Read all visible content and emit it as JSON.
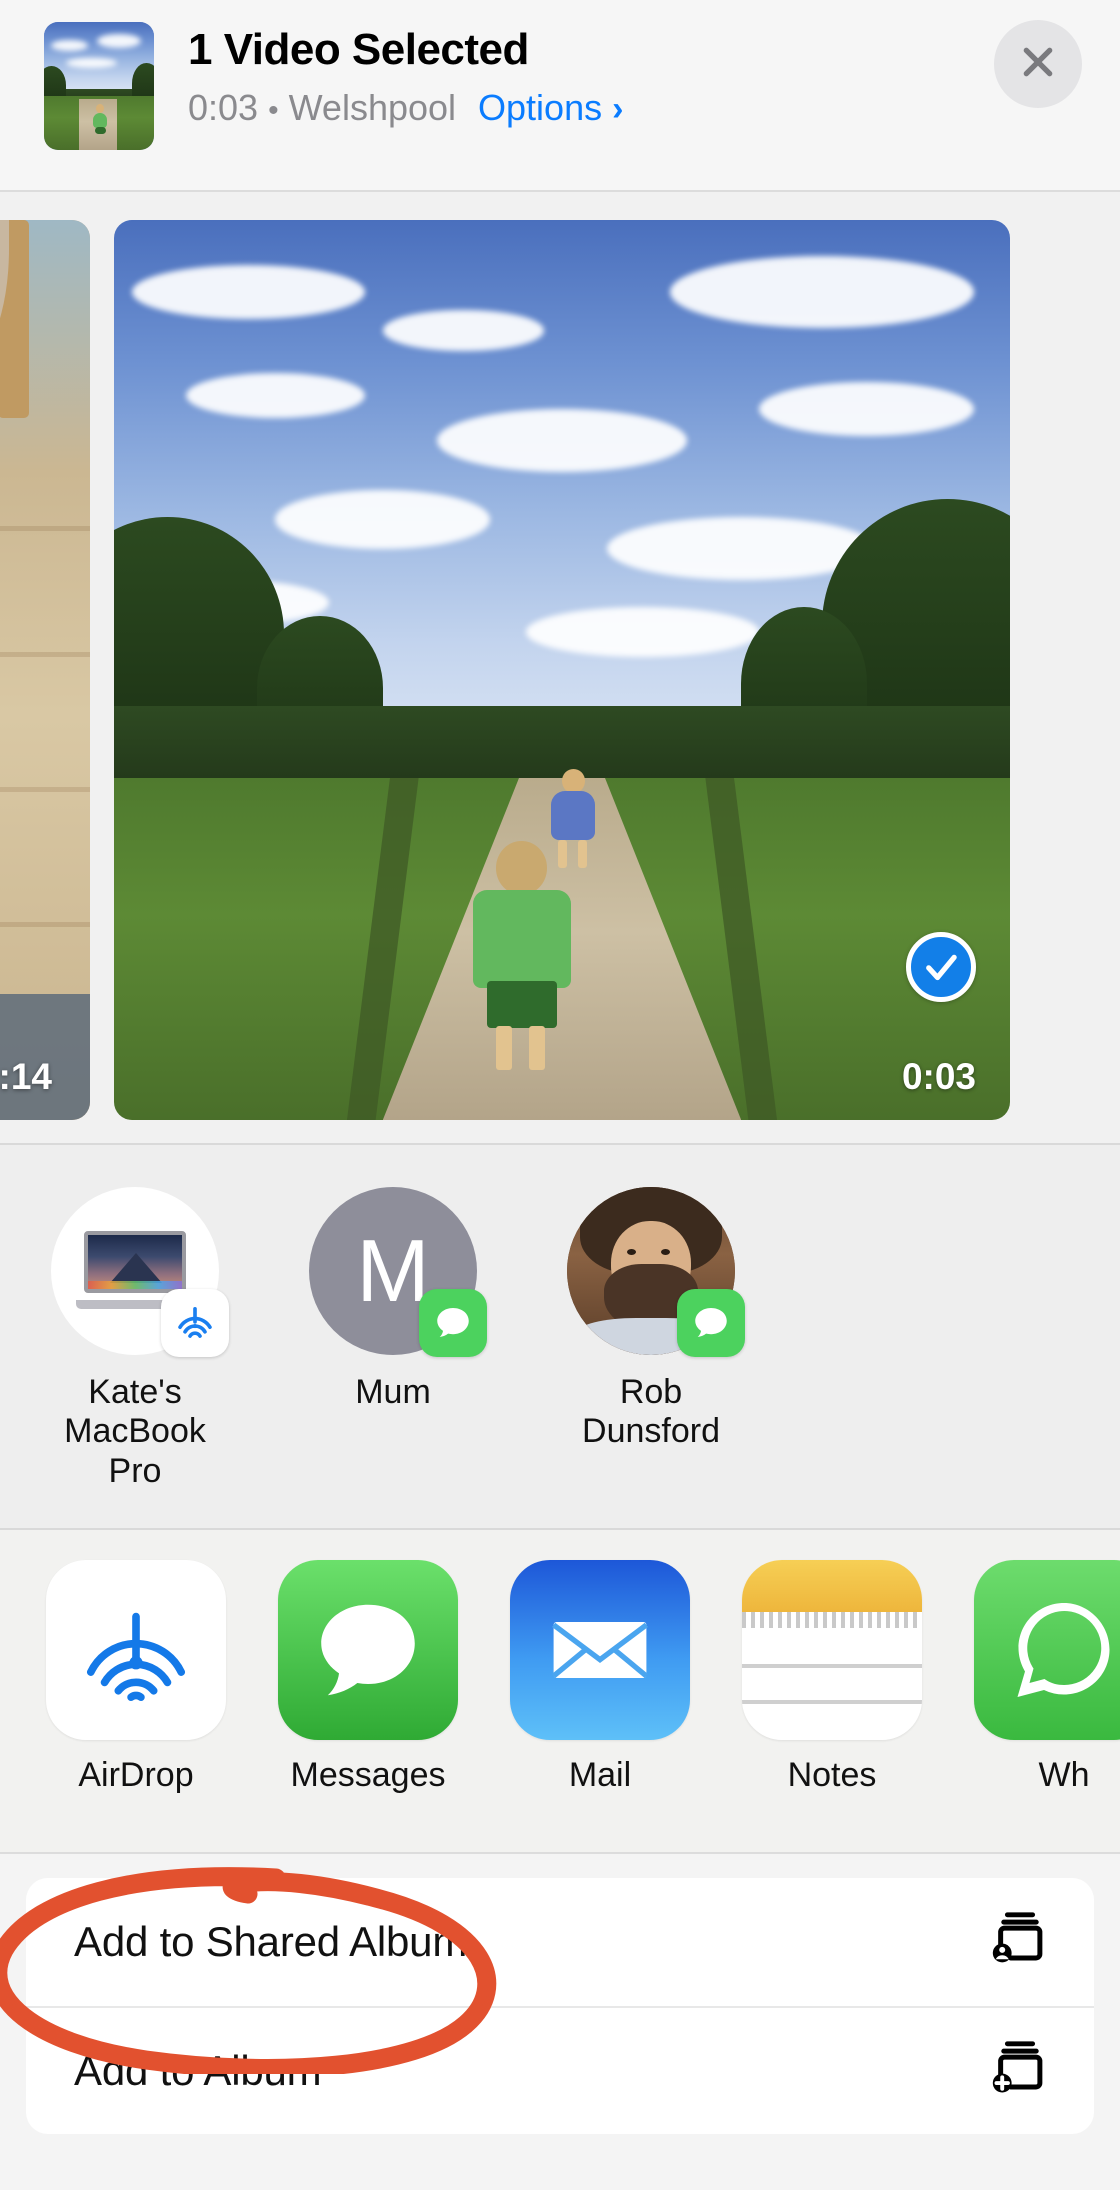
{
  "header": {
    "title": "1 Video Selected",
    "duration": "0:03",
    "separator": "•",
    "location": "Welshpool",
    "options_label": "Options",
    "options_chevron": "›",
    "close_icon": "close-icon",
    "thumbnail_icon": "video-thumbnail"
  },
  "photo_strip": {
    "previous": {
      "duration": ":14",
      "selected": false,
      "select_icon": "unselected-circle-icon"
    },
    "current": {
      "duration": "0:03",
      "selected": true,
      "select_icon": "checkmark-circle-icon"
    }
  },
  "contacts": [
    {
      "name": "Kate's\nMacBook Pro",
      "name_line1": "Kate's",
      "name_line2": "MacBook Pro",
      "avatar_type": "device",
      "badge_icon": "airdrop-icon",
      "badge_kind": "airdrop"
    },
    {
      "name": "Mum",
      "name_line1": "Mum",
      "name_line2": "",
      "avatar_type": "initial",
      "initial": "M",
      "badge_icon": "messages-icon",
      "badge_kind": "messages"
    },
    {
      "name": "Rob Dunsford",
      "name_line1": "Rob",
      "name_line2": "Dunsford",
      "avatar_type": "photo",
      "badge_icon": "messages-icon",
      "badge_kind": "messages"
    }
  ],
  "apps": [
    {
      "label": "AirDrop",
      "icon": "airdrop-icon"
    },
    {
      "label": "Messages",
      "icon": "messages-icon"
    },
    {
      "label": "Mail",
      "icon": "mail-icon"
    },
    {
      "label": "Notes",
      "icon": "notes-icon"
    },
    {
      "label": "Wh",
      "icon": "whatsapp-icon"
    }
  ],
  "actions": [
    {
      "label": "Add to Shared Album",
      "icon": "add-to-shared-album-icon",
      "highlighted": true
    },
    {
      "label": "Add to Album",
      "icon": "add-to-album-icon",
      "highlighted": false
    }
  ],
  "annotation": {
    "shape": "ellipse",
    "target": "Add to Shared Album",
    "color": "#e2512f"
  },
  "colors": {
    "accent_blue": "#0a7cff",
    "select_blue": "#127fe8",
    "messages_green": "#4cd25e",
    "annotation_red": "#e2512f",
    "sheet_background": "#f2f2f2",
    "card_background": "#ffffff",
    "secondary_text": "#8a8a8e"
  }
}
